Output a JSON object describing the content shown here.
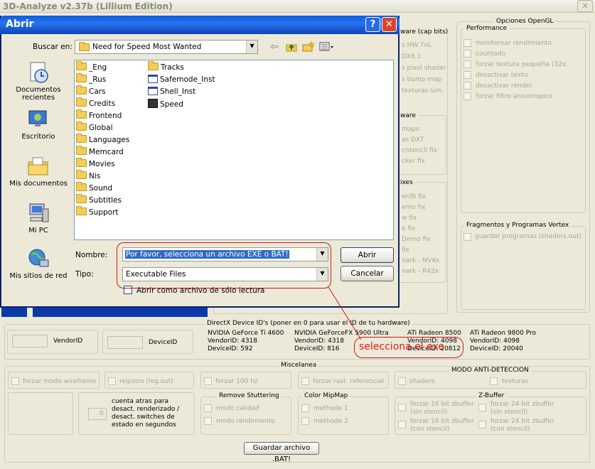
{
  "window": {
    "title": "3D-Analyze v2.37b (Lillium Edition)",
    "close": "✕"
  },
  "dialog": {
    "title": "Abrir",
    "help": "?",
    "close": "✕",
    "look_in_label": "Buscar en:",
    "look_in_value": "Need for Speed Most Wanted",
    "sidebar": [
      {
        "label": "Documentos recientes",
        "icon": "recent-documents-icon"
      },
      {
        "label": "Escritorio",
        "icon": "desktop-icon"
      },
      {
        "label": "Mis documentos",
        "icon": "my-documents-icon"
      },
      {
        "label": "Mi PC",
        "icon": "my-computer-icon"
      },
      {
        "label": "Mis sitios de red",
        "icon": "network-places-icon"
      }
    ],
    "files_col1": [
      "_Eng",
      "_Rus",
      "Cars",
      "Credits",
      "Frontend",
      "Global",
      "Languages",
      "Memcard",
      "Movies",
      "Nis",
      "Sound",
      "Subtitles",
      "Support"
    ],
    "files_col2": [
      {
        "name": "Tracks",
        "kind": "folder"
      },
      {
        "name": "Safemode_Inst",
        "kind": "file"
      },
      {
        "name": "Shell_Inst",
        "kind": "file"
      },
      {
        "name": "Speed",
        "kind": "exe"
      }
    ],
    "filename_label": "Nombre:",
    "filename_value": "Por favor, selecciona un archivo EXE o BAT!",
    "filetype_label": "Tipo:",
    "filetype_value": "Executable Files",
    "open_button": "Abrir",
    "cancel_button": "Cancelar",
    "readonly_label": "Abrir como archivo de sólo lectura"
  },
  "annotation": {
    "text": "selecciona el exe",
    "color": "#e01c1c"
  },
  "partial_right": {
    "hw_title": "ware (cap bits)",
    "hw_items": [
      "s HW TnL",
      "DX8.1",
      "s pixel shader",
      "s bump map",
      "texturas sim."
    ],
    "ware_title": "ware",
    "ware_items": [
      "maps",
      "as DXT",
      "r/stencil fix",
      "cker fix"
    ],
    "fixes_title": "ixes",
    "fixes_items": [
      "er/lb fix",
      "emo fix",
      "w fix",
      "e fix",
      "Demo fix",
      "fix",
      "nark - NV4x",
      "nark - R42x"
    ]
  },
  "opengl": {
    "title": "Opciones OpenGL",
    "performance_title": "Performance",
    "performance_items": [
      "monitorear rendimiento",
      "countado",
      "forzar textura pequeña (32x",
      "desactivar textu",
      "desactivar render",
      "forzar filtro anisotropico"
    ],
    "fragments_title": "Fragmentos y Programas Vertex",
    "fragments_items": [
      "guardar programas (shaders.out)"
    ]
  },
  "directx": {
    "title": "DirectX Device ID's (poner en 0 para usar el ID de tu hardware)",
    "vendor_label": "VendorID",
    "device_label": "DeviceID",
    "cards": [
      {
        "name": "NVIDIA GeForce Ti 4600",
        "vendor": "VendorID: 4318",
        "device": "DeviceID: 592"
      },
      {
        "name": "NVIDIA GeForceFX 5900 Ultra",
        "vendor": "VendorID: 4318",
        "device": "DeviceID: 816"
      },
      {
        "name": "ATi Radeon 8500",
        "vendor": "VendorID: 4098",
        "device": "DeviceID: 20812"
      },
      {
        "name": "ATi Radeon 9800 Pro",
        "vendor": "VendorID: 4098",
        "device": "DeviceID: 20040"
      }
    ]
  },
  "misc": {
    "title": "Miscelanea",
    "wireframe": "forzar modo wireframe",
    "log": "registro (log.out)",
    "hz": "forzar 100 hz",
    "rast": "forzar rast. referencial",
    "anti_title": "MODO ANTI-DETECCION",
    "shaders": "shaders",
    "texturas": "texturas",
    "countdown_value": "0",
    "countdown_text": "cuenta atras para desact. renderizado / desact. switches de estado en segundos",
    "stutter_title": "Remove Stuttering",
    "stutter_items": [
      "modo calidad",
      "modo rendimiento"
    ],
    "mipmap_title": "Color MipMap",
    "mipmap_items": [
      "methode 1",
      "methode 2"
    ],
    "zbuffer_title": "Z-Buffer",
    "zbuffer_items": [
      "forzar 16 bit zbuffer (sin stencil)",
      "forzar 24 bit zbuffer (sin stencil)",
      "forzar 16 bit zbuffer (con stencil)",
      "forzar 24 bit zbuffer (con stencil)"
    ],
    "save_button": "Guardar archivo .BAT!"
  }
}
